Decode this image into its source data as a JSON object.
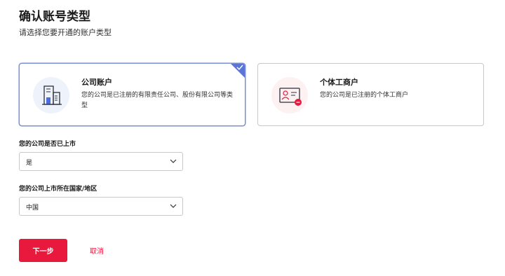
{
  "page": {
    "title": "确认账号类型",
    "subtitle": "请选择您要开通的账户类型"
  },
  "account_types": [
    {
      "title": "公司账户",
      "description": "您的公司是已注册的有限责任公司、股份有限公司等类型",
      "icon": "building-icon",
      "selected": true
    },
    {
      "title": "个体工商户",
      "description": "您的公司是已注册的个体工商户",
      "icon": "id-card-icon",
      "selected": false
    }
  ],
  "form": {
    "listed": {
      "label": "您的公司是否已上市",
      "value": "是"
    },
    "country": {
      "label": "您的公司上市所在国家/地区",
      "value": "中国"
    }
  },
  "actions": {
    "next_label": "下一步",
    "cancel_label": "取消"
  },
  "colors": {
    "accent": "#e8193c",
    "selected_border": "#5b74d8"
  }
}
